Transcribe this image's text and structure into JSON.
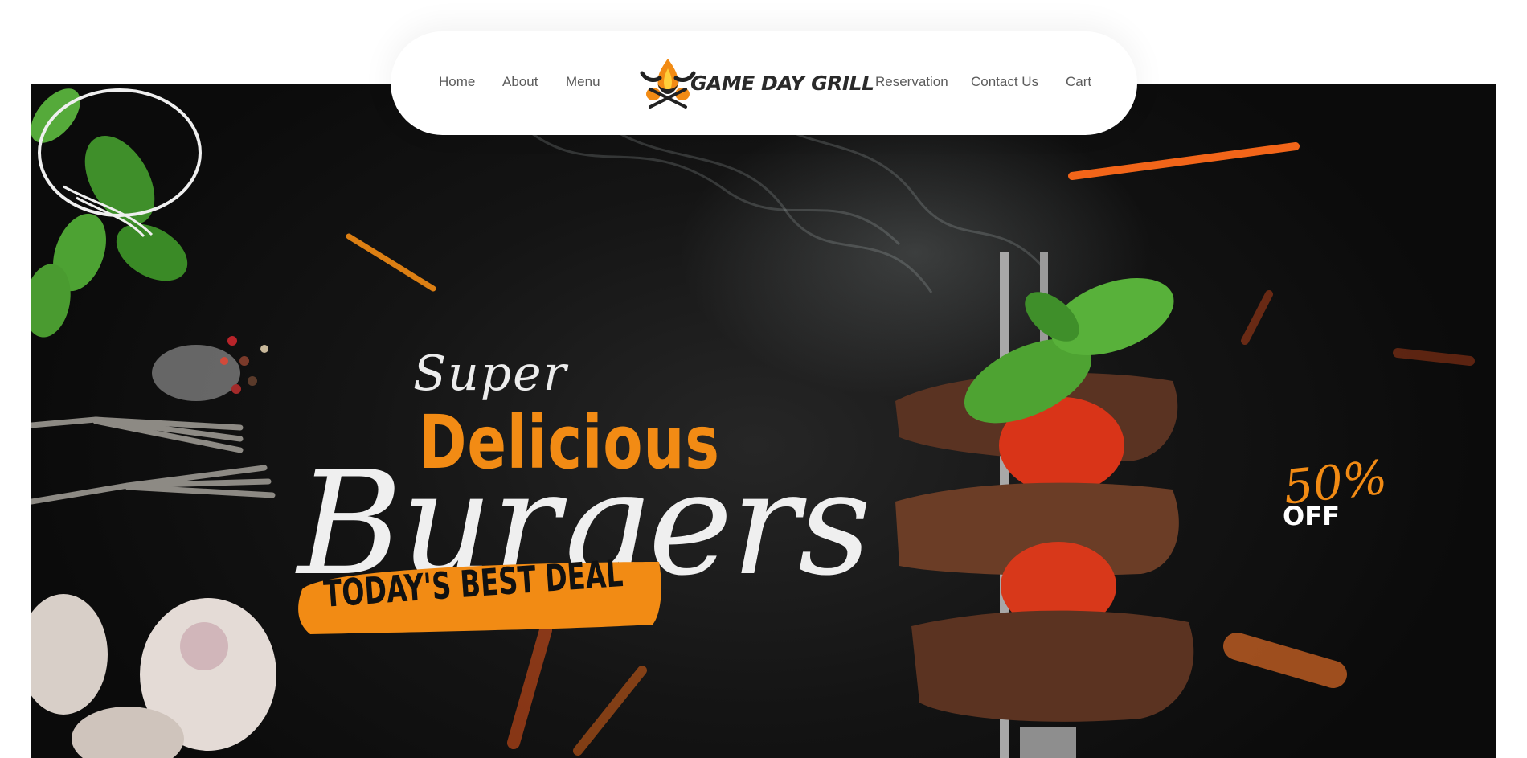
{
  "nav": {
    "links_left": [
      "Home",
      "About",
      "Menu"
    ],
    "links_right": [
      "Reservation",
      "Contact Us",
      "Cart"
    ],
    "logo_text": "GAME DAY GRILL"
  },
  "hero": {
    "super": "Super",
    "delicious": "Delicious",
    "burgers": "Burgers",
    "deal": "TODAY'S BEST DEAL",
    "badge_percent": "50%",
    "badge_off": "OFF"
  },
  "colors": {
    "accent_orange": "#f28b14",
    "nav_text": "#5c5c5c",
    "hero_background": "#141414",
    "headline_white": "#efefef"
  },
  "icons": [
    "bull-flame-logo-icon",
    "crossed-spatulas-icon"
  ]
}
